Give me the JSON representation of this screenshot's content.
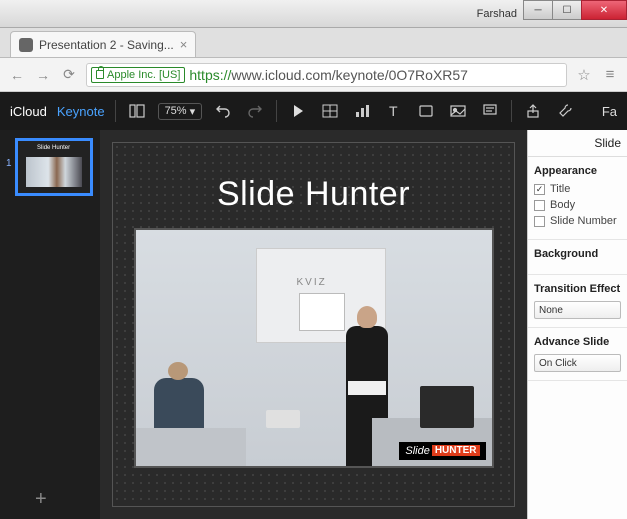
{
  "window": {
    "user_label": "Farshad"
  },
  "browser": {
    "tab_title": "Presentation 2 - Saving...",
    "ssl_org": "Apple Inc. [US]",
    "url_protocol": "https://",
    "url_rest": "www.icloud.com/keynote/0O7RoXR57"
  },
  "appbar": {
    "brand1": "iCloud",
    "brand2": "Keynote",
    "zoom": "75%",
    "right_label": "Fa"
  },
  "slidenav": {
    "items": [
      {
        "num": "1",
        "title": "Slide Hunter"
      }
    ]
  },
  "slide": {
    "title": "Slide Hunter",
    "photo_board_text": "KVIZ",
    "watermark_a": "Slide",
    "watermark_b": "HUNTER"
  },
  "panel": {
    "tab_label": "Slide",
    "appearance": {
      "heading": "Appearance",
      "title_label": "Title",
      "title_checked": true,
      "body_label": "Body",
      "body_checked": false,
      "slidenum_label": "Slide Number",
      "slidenum_checked": false
    },
    "background_heading": "Background",
    "transition": {
      "heading": "Transition Effect",
      "value": "None"
    },
    "advance": {
      "heading": "Advance Slide",
      "value": "On Click"
    }
  }
}
